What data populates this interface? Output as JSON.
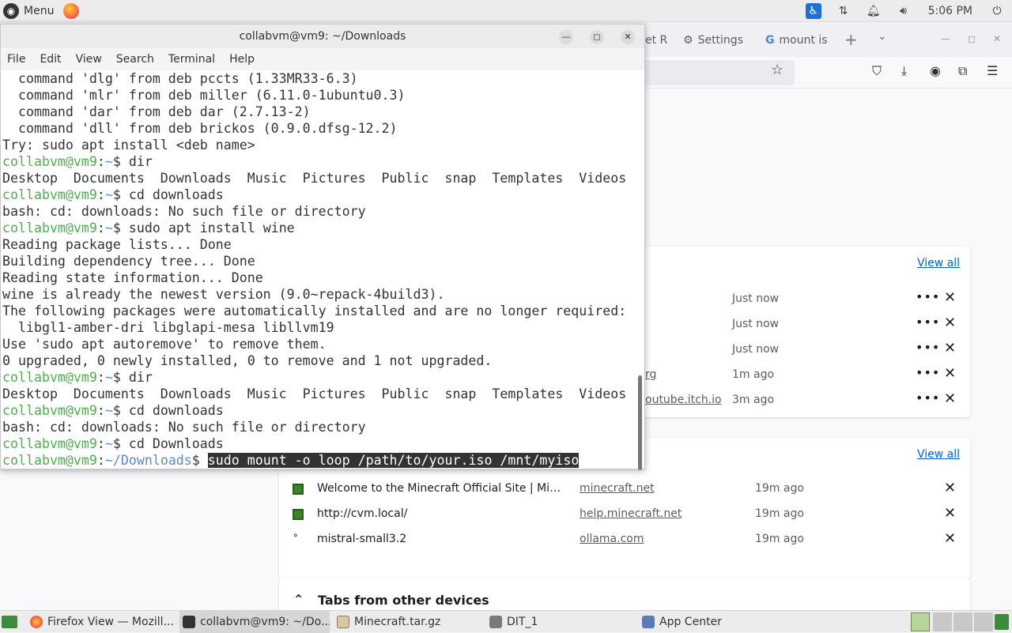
{
  "panel": {
    "menu_label": "Menu",
    "clock": "5:06 PM"
  },
  "firefox": {
    "tabs": [
      {
        "label": "et R"
      },
      {
        "label": "Settings"
      },
      {
        "label": "mount is"
      }
    ],
    "downloads": {
      "view_all": "View all",
      "rows": [
        {
          "name": "",
          "time": "Just now"
        },
        {
          "name": "",
          "time": "Just now"
        },
        {
          "name": "",
          "time": "Just now"
        },
        {
          "name": "rg",
          "time": "1m ago"
        },
        {
          "name": "outube.itch.io",
          "time": "3m ago"
        }
      ]
    },
    "history": {
      "view_all": "View all",
      "rows": [
        {
          "title": "Welcome to the Minecraft Official Site | Min...",
          "domain": "minecraft.net",
          "time": "19m ago"
        },
        {
          "title": "http://cvm.local/",
          "domain": "help.minecraft.net",
          "time": "19m ago"
        },
        {
          "title": "mistral-small3.2",
          "domain": "ollama.com",
          "time": "19m ago"
        }
      ]
    },
    "other_devices": "Tabs from other devices"
  },
  "terminal": {
    "title": "collabvm@vm9: ~/Downloads",
    "menu": [
      "File",
      "Edit",
      "View",
      "Search",
      "Terminal",
      "Help"
    ],
    "lines": [
      {
        "t": "  command 'dlg' from deb pccts (1.33MR33-6.3)"
      },
      {
        "t": "  command 'mlr' from deb miller (6.11.0-1ubuntu0.3)"
      },
      {
        "t": "  command 'dar' from deb dar (2.7.13-2)"
      },
      {
        "t": "  command 'dll' from deb brickos (0.9.0.dfsg-12.2)"
      },
      {
        "t": "Try: sudo apt install <deb name>"
      },
      {
        "p": "collabvm@vm9",
        "d": "~",
        "c": "dir"
      },
      {
        "t": "Desktop  Documents  Downloads  Music  Pictures  Public  snap  Templates  Videos"
      },
      {
        "p": "collabvm@vm9",
        "d": "~",
        "c": "cd downloads"
      },
      {
        "t": "bash: cd: downloads: No such file or directory"
      },
      {
        "p": "collabvm@vm9",
        "d": "~",
        "c": "sudo apt install wine"
      },
      {
        "t": "Reading package lists... Done"
      },
      {
        "t": "Building dependency tree... Done"
      },
      {
        "t": "Reading state information... Done"
      },
      {
        "t": "wine is already the newest version (9.0~repack-4build3)."
      },
      {
        "t": "The following packages were automatically installed and are no longer required:"
      },
      {
        "t": "  libgl1-amber-dri libglapi-mesa libllvm19"
      },
      {
        "t": "Use 'sudo apt autoremove' to remove them."
      },
      {
        "t": "0 upgraded, 0 newly installed, 0 to remove and 1 not upgraded."
      },
      {
        "p": "collabvm@vm9",
        "d": "~",
        "c": "dir"
      },
      {
        "t": "Desktop  Documents  Downloads  Music  Pictures  Public  snap  Templates  Videos"
      },
      {
        "p": "collabvm@vm9",
        "d": "~",
        "c": "cd downloads"
      },
      {
        "t": "bash: cd: downloads: No such file or directory"
      },
      {
        "p": "collabvm@vm9",
        "d": "~",
        "c": "cd Downloads"
      },
      {
        "p": "collabvm@vm9",
        "d": "~/Downloads",
        "c": "sudo mount -o loop /path/to/your.iso /mnt/myiso",
        "sel": true
      }
    ]
  },
  "taskbar": {
    "items": [
      {
        "label": "Firefox View — Mozill...",
        "icon": "firefox-icon"
      },
      {
        "label": "collabvm@vm9: ~/Do...",
        "icon": "terminal-icon",
        "active": true
      },
      {
        "label": "Minecraft.tar.gz",
        "icon": "archive-icon"
      },
      {
        "label": "DIT_1",
        "icon": "folder-icon"
      },
      {
        "label": "App Center",
        "icon": "app-center-icon"
      }
    ]
  }
}
